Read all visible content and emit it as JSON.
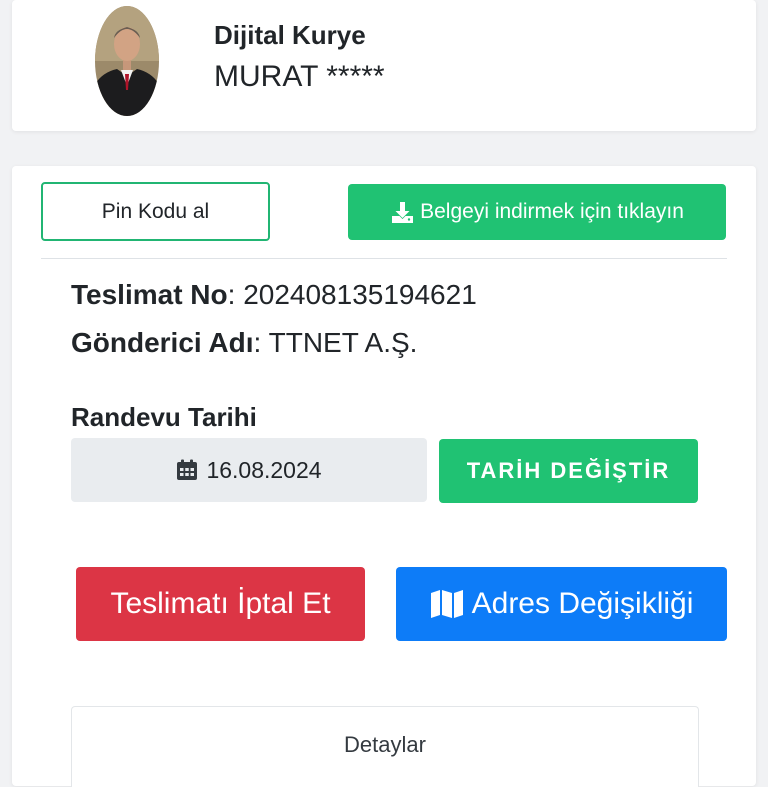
{
  "profile": {
    "role": "Dijital Kurye",
    "name": "MURAT *****"
  },
  "actions": {
    "pin_label": "Pin Kodu al",
    "download_label": "Belgeyi indirmek için tıklayın",
    "download_icon": "download-icon"
  },
  "delivery": {
    "number_label": "Teslimat No",
    "number_value": "202408135194621",
    "sender_label": "Gönderici Adı",
    "sender_value": "TTNET A.Ş."
  },
  "appointment": {
    "heading": "Randevu Tarihi",
    "date_value": "16.08.2024",
    "date_icon": "calendar-icon",
    "change_label": "TARİH DEĞİŞTİR"
  },
  "buttons": {
    "cancel_label": "Teslimatı İptal Et",
    "address_label": "Adres Değişikliği",
    "address_icon": "map-icon"
  },
  "details": {
    "label": "Detaylar"
  },
  "colors": {
    "green": "#20c273",
    "red": "#dc3545",
    "blue": "#0d7cf8",
    "field_gray": "#e9ecef"
  }
}
